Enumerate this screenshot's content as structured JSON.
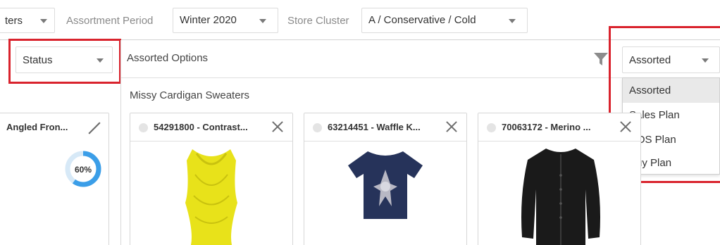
{
  "filters": {
    "partial_dropdown_value": "ters",
    "assortment_period_label": "Assortment Period",
    "assortment_period_value": "Winter 2020",
    "store_cluster_label": "Store Cluster",
    "store_cluster_value": "A / Conservative / Cold"
  },
  "left_panel": {
    "status_value": "Status",
    "card_title": "Angled Fron...",
    "progress_percent": 60,
    "progress_label": "60%"
  },
  "main": {
    "title": "Assorted Options",
    "group_title": "Missy Cardigan Sweaters",
    "view_select_value": "Assorted",
    "view_options": [
      "Assorted",
      "Sales Plan",
      "ROS Plan",
      "Buy Plan"
    ],
    "selected_option_index": 0
  },
  "cards": [
    {
      "title": "54291800 - Contrast...",
      "garment": "yellow-draped-top",
      "color": "#e8e21a"
    },
    {
      "title": "63214451 - Waffle K...",
      "garment": "navy-graphic-tee",
      "color": "#26335a"
    },
    {
      "title": "70063172 - Merino ...",
      "garment": "black-cardigan",
      "color": "#1a1a1a"
    }
  ],
  "colors": {
    "highlight_red": "#d9232d",
    "progress_blue": "#3b9ee8",
    "progress_track": "#d7e9f7"
  }
}
